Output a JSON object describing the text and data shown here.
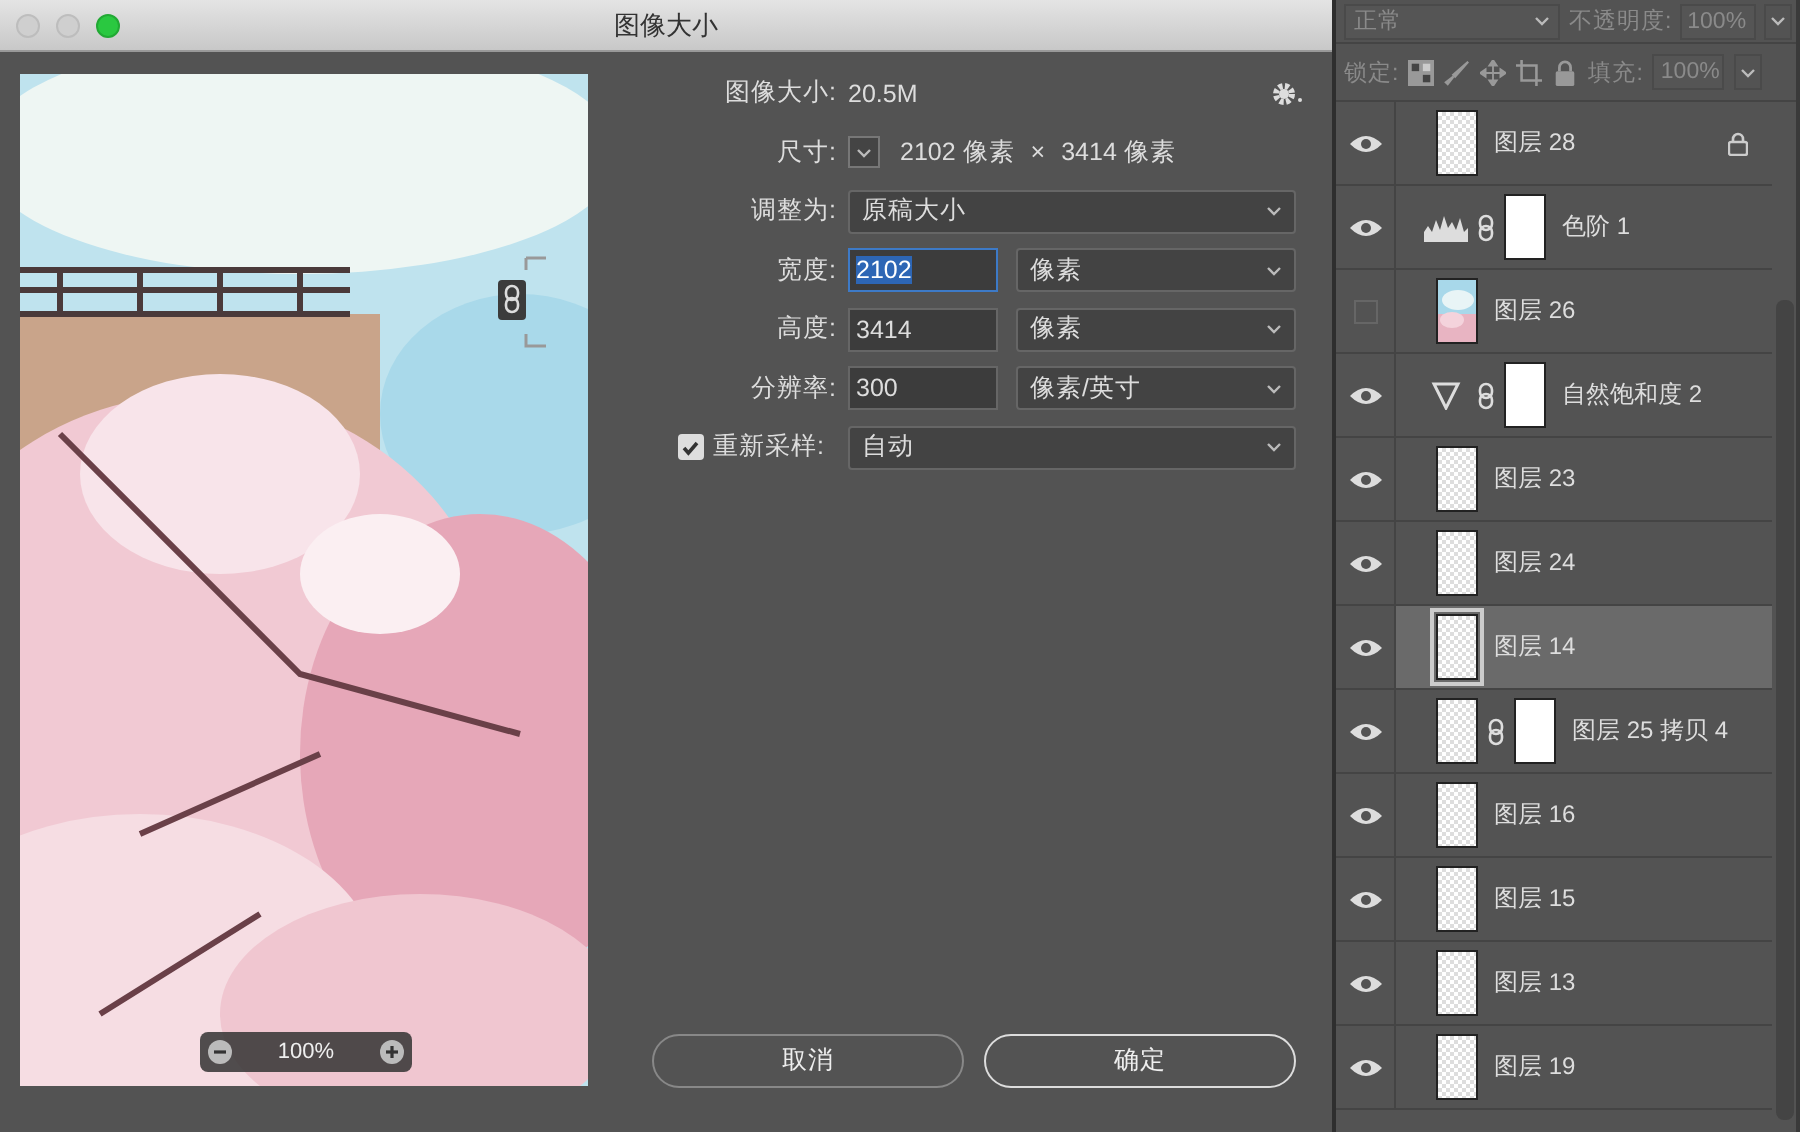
{
  "window": {
    "title": "图像大小"
  },
  "window_controls": [
    {
      "enabled": false
    },
    {
      "enabled": false
    },
    {
      "enabled": true
    }
  ],
  "preview": {
    "kind": "picture",
    "zoom": "100%"
  },
  "image_size": {
    "label": "图像大小:",
    "value": "20.5M"
  },
  "dimensions": {
    "label": "尺寸:",
    "width": "2102 像素",
    "times": "×",
    "height": "3414 像素"
  },
  "fit_to": {
    "label": "调整为:",
    "value": "原稿大小"
  },
  "fields": [
    {
      "label": "宽度:",
      "value": "2102",
      "unit": "像素",
      "focused": true
    },
    {
      "label": "高度:",
      "value": "3414",
      "unit": "像素",
      "focused": false
    },
    {
      "label": "分辨率:",
      "value": "300",
      "unit": "像素/英寸",
      "focused": false
    }
  ],
  "resample": {
    "label": "重新采样:",
    "checked": true,
    "value": "自动"
  },
  "buttons": [
    {
      "label": "取消",
      "default": false
    },
    {
      "label": "确定",
      "default": true
    }
  ],
  "layers_panel": {
    "blend_mode": "正常",
    "opacity_label": "不透明度:",
    "opacity": "100%",
    "lock_label": "锁定:",
    "fill_label": "填充:",
    "fill": "100%",
    "layers": [
      {
        "name": "图层 28",
        "kind": "pixel",
        "visible": true,
        "selected": false,
        "locked": true,
        "mask": false
      },
      {
        "name": "色阶 1",
        "kind": "levels",
        "visible": true,
        "selected": false,
        "locked": false,
        "mask": true
      },
      {
        "name": "图层 26",
        "visible": false,
        "selected": false,
        "locked": false,
        "mask": false
      },
      {
        "name": "自然饱和度 2",
        "kind": "vibrance",
        "visible": true,
        "selected": false,
        "locked": false,
        "mask": true
      },
      {
        "name": "图层 23",
        "kind": "pixel",
        "visible": true,
        "selected": false,
        "locked": false,
        "mask": false
      },
      {
        "name": "图层 24",
        "kind": "pixel",
        "visible": true,
        "selected": false,
        "locked": false,
        "mask": false
      },
      {
        "name": "图层 14",
        "kind": "pixel",
        "visible": true,
        "selected": true,
        "locked": false,
        "mask": false
      },
      {
        "name": "图层 25 拷贝 4",
        "kind": "pixel",
        "visible": true,
        "selected": false,
        "locked": false,
        "mask": true
      },
      {
        "name": "图层 16",
        "kind": "pixel",
        "visible": true,
        "selected": false,
        "locked": false,
        "mask": false
      },
      {
        "name": "图层 15",
        "kind": "pixel",
        "visible": true,
        "selected": false,
        "locked": false,
        "mask": false
      },
      {
        "name": "图层 13",
        "kind": "pixel",
        "visible": true,
        "selected": false,
        "locked": false,
        "mask": false
      },
      {
        "name": "图层 19",
        "kind": "pixel",
        "visible": true,
        "selected": false,
        "locked": false,
        "mask": false
      }
    ]
  }
}
